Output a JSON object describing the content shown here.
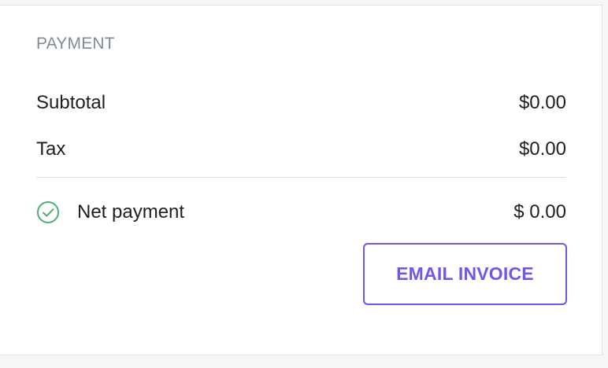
{
  "payment": {
    "section_title": "PAYMENT",
    "subtotal_label": "Subtotal",
    "subtotal_value": "$0.00",
    "tax_label": "Tax",
    "tax_value": "$0.00",
    "net_label": "Net payment",
    "net_value": "$ 0.00",
    "email_button_label": "EMAIL INVOICE",
    "net_icon": "check-circle-icon"
  },
  "colors": {
    "accent": "#7356e8",
    "success": "#4caf72",
    "muted_heading": "#7f8b96"
  }
}
